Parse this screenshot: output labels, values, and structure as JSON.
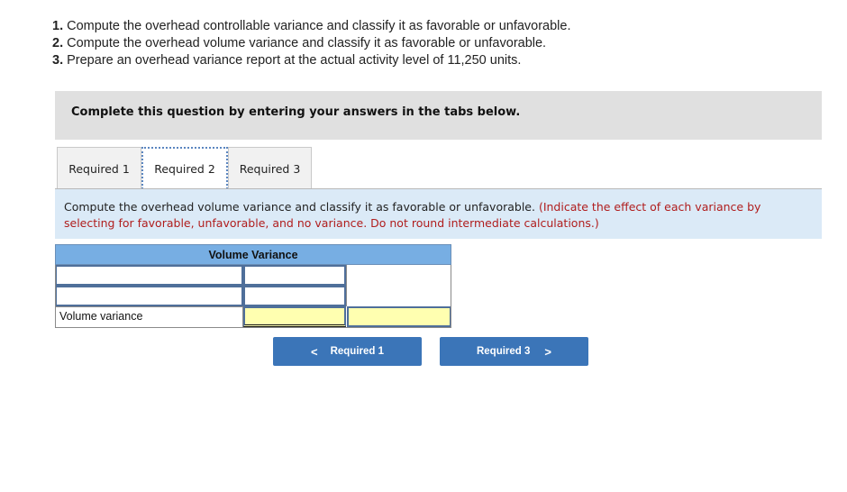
{
  "questions": [
    {
      "number": "1.",
      "text": " Compute the overhead controllable variance and classify it as favorable or unfavorable."
    },
    {
      "number": "2.",
      "text": " Compute the overhead volume variance and classify it as favorable or unfavorable."
    },
    {
      "number": "3.",
      "text": " Prepare an overhead variance report at the actual activity level of 11,250 units."
    }
  ],
  "instruction": "Complete this question by entering your answers in the tabs below.",
  "tabs": [
    {
      "label": "Required 1",
      "active": false
    },
    {
      "label": "Required 2",
      "active": true
    },
    {
      "label": "Required 3",
      "active": false
    }
  ],
  "prompt": {
    "main": "Compute the overhead volume variance and classify it as favorable or unfavorable. ",
    "note": "(Indicate the effect of each variance by selecting for favorable, unfavorable, and no variance. Do not round intermediate calculations.)"
  },
  "table": {
    "title": "Volume Variance",
    "rows": [
      {
        "label_value": "",
        "amount_value": ""
      },
      {
        "label_value": "",
        "amount_value": ""
      },
      {
        "label": "Volume variance",
        "amount_value": "",
        "effect_value": ""
      }
    ]
  },
  "nav": {
    "prev_label": "Required 1",
    "next_label": "Required 3",
    "prev_icon": "chevron-left-icon",
    "next_icon": "chevron-right-icon"
  },
  "colors": {
    "header_blue": "#77aee3",
    "button_blue": "#3b75b8",
    "prompt_bg": "#dbeaf7",
    "note_red": "#b01d1d",
    "answer_yellow": "#ffffb0"
  }
}
